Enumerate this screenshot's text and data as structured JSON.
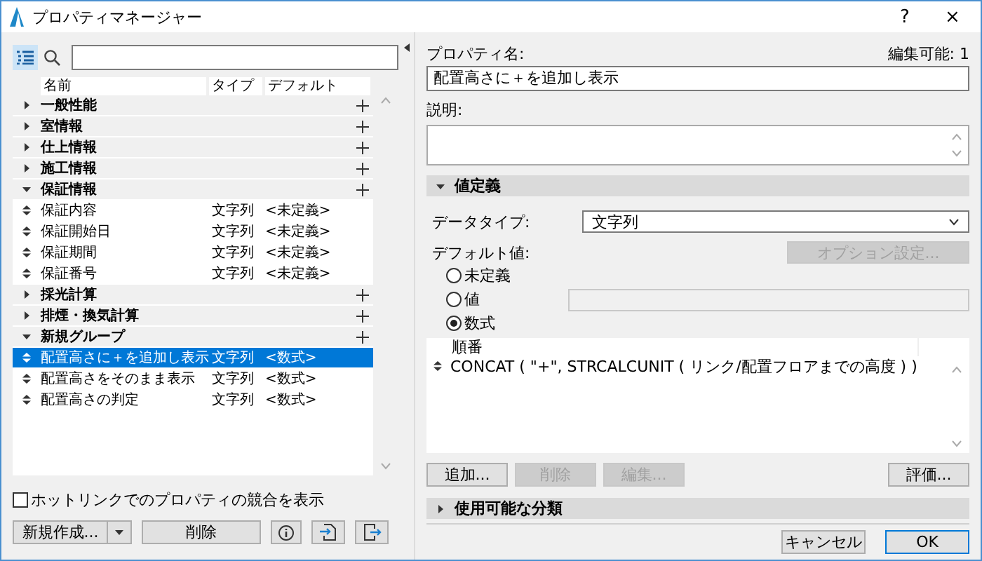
{
  "window": {
    "title": "プロパティマネージャー",
    "help": "?",
    "close": "×"
  },
  "left": {
    "columns": [
      "名前",
      "タイプ",
      "デフォルト"
    ],
    "groups": [
      {
        "label": "一般性能",
        "expanded": false
      },
      {
        "label": "室情報",
        "expanded": false
      },
      {
        "label": "仕上情報",
        "expanded": false
      },
      {
        "label": "施工情報",
        "expanded": false
      },
      {
        "label": "保証情報",
        "expanded": true,
        "children": [
          {
            "label": "保証内容",
            "type": "文字列",
            "default": "<未定義>",
            "selected": false
          },
          {
            "label": "保証開始日",
            "type": "文字列",
            "default": "<未定義>",
            "selected": false
          },
          {
            "label": "保証期間",
            "type": "文字列",
            "default": "<未定義>",
            "selected": false
          },
          {
            "label": "保証番号",
            "type": "文字列",
            "default": "<未定義>",
            "selected": false
          }
        ]
      },
      {
        "label": "採光計算",
        "expanded": false
      },
      {
        "label": "排煙・換気計算",
        "expanded": false
      },
      {
        "label": "新規グループ",
        "expanded": true,
        "children": [
          {
            "label": "配置高さに＋を追加し表示",
            "type": "文字列",
            "default": "<数式>",
            "selected": true
          },
          {
            "label": "配置高さをそのまま表示",
            "type": "文字列",
            "default": "<数式>",
            "selected": false
          },
          {
            "label": "配置高さの判定",
            "type": "文字列",
            "default": "<数式>",
            "selected": false
          }
        ]
      }
    ],
    "hotlink": {
      "label": "ホットリンクでのプロパティの競合を表示",
      "checked": false
    },
    "new_button": "新規作成...",
    "delete_button": "削除"
  },
  "right": {
    "name_label": "プロパティ名:",
    "editable": "編集可能: 1",
    "name_value": "配置高さに＋を追加し表示",
    "description_label": "説明:",
    "value_section": {
      "label": "値定義",
      "expanded": true
    },
    "data_type_label": "データタイプ:",
    "data_type_value": "文字列",
    "default_label": "デフォルト値:",
    "option_button": {
      "label": "オプション設定...",
      "disabled": true
    },
    "radios": [
      {
        "label": "未定義",
        "selected": false
      },
      {
        "label": "値",
        "selected": false
      },
      {
        "label": "数式",
        "selected": true
      }
    ],
    "formula_header": "順番",
    "formulas": [
      "CONCAT ( \"+\", STRCALCUNIT ( リンク/配置フロアまでの高度 ) )"
    ],
    "formula_buttons": [
      {
        "label": "追加...",
        "disabled": false
      },
      {
        "label": "削除",
        "disabled": true
      },
      {
        "label": "編集...",
        "disabled": true
      }
    ],
    "evaluate_button": {
      "label": "評価...",
      "disabled": false
    },
    "classification_section": {
      "label": "使用可能な分類",
      "expanded": false
    }
  },
  "dialog_buttons": [
    {
      "label": "キャンセル",
      "default": false
    },
    {
      "label": "OK",
      "default": true
    }
  ]
}
